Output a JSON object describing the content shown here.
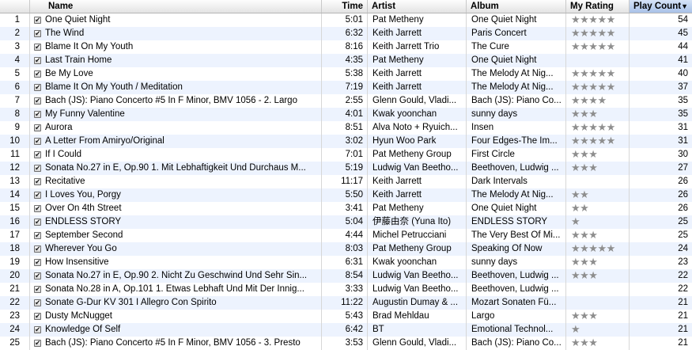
{
  "columns": {
    "name": "Name",
    "time": "Time",
    "artist": "Artist",
    "album": "Album",
    "rating": "My Rating",
    "plays": "Play Count",
    "sort_indicator": "▼"
  },
  "tracks": [
    {
      "num": "1",
      "name": "One Quiet Night",
      "time": "5:01",
      "artist": "Pat Metheny",
      "album": "One Quiet Night",
      "rating": "★★★★★",
      "plays": "54"
    },
    {
      "num": "2",
      "name": "The Wind",
      "time": "6:32",
      "artist": "Keith Jarrett",
      "album": "Paris Concert",
      "rating": "★★★★★",
      "plays": "45"
    },
    {
      "num": "3",
      "name": "Blame It On My Youth",
      "time": "8:16",
      "artist": "Keith Jarrett Trio",
      "album": "The Cure",
      "rating": "★★★★★",
      "plays": "44"
    },
    {
      "num": "4",
      "name": "Last Train Home",
      "time": "4:35",
      "artist": "Pat Metheny",
      "album": "One Quiet Night",
      "rating": "",
      "plays": "41"
    },
    {
      "num": "5",
      "name": "Be My Love",
      "time": "5:38",
      "artist": "Keith Jarrett",
      "album": "The Melody At Nig...",
      "rating": "★★★★★",
      "plays": "40"
    },
    {
      "num": "6",
      "name": "Blame It On My Youth / Meditation",
      "time": "7:19",
      "artist": "Keith Jarrett",
      "album": "The Melody At Nig...",
      "rating": "★★★★★",
      "plays": "37"
    },
    {
      "num": "7",
      "name": "Bach (JS): Piano Concerto #5 In F Minor, BMV 1056 - 2. Largo",
      "time": "2:55",
      "artist": "Glenn Gould, Vladi...",
      "album": "Bach (JS): Piano Co...",
      "rating": "★★★★",
      "plays": "35"
    },
    {
      "num": "8",
      "name": "My Funny Valentine",
      "time": "4:01",
      "artist": "Kwak yoonchan",
      "album": "sunny days",
      "rating": "★★★",
      "plays": "35"
    },
    {
      "num": "9",
      "name": "Aurora",
      "time": "8:51",
      "artist": "Alva Noto + Ryuich...",
      "album": "Insen",
      "rating": "★★★★★",
      "plays": "31"
    },
    {
      "num": "10",
      "name": "A Letter From Amiryo/Original",
      "time": "3:02",
      "artist": "Hyun Woo Park",
      "album": "Four Edges-The Im...",
      "rating": "★★★★★",
      "plays": "31"
    },
    {
      "num": "11",
      "name": "If I Could",
      "time": "7:01",
      "artist": "Pat Metheny Group",
      "album": "First Circle",
      "rating": "★★★",
      "plays": "30"
    },
    {
      "num": "12",
      "name": "Sonata No.27 in E, Op.90 1. Mit Lebhaftigkeit Und Durchaus M...",
      "time": "5:19",
      "artist": "Ludwig Van Beetho...",
      "album": "Beethoven, Ludwig ...",
      "rating": "★★★",
      "plays": "27"
    },
    {
      "num": "13",
      "name": "Recitative",
      "time": "11:17",
      "artist": "Keith Jarrett",
      "album": "Dark Intervals",
      "rating": "",
      "plays": "26"
    },
    {
      "num": "14",
      "name": "I Loves You, Porgy",
      "time": "5:50",
      "artist": "Keith Jarrett",
      "album": "The Melody At Nig...",
      "rating": "★★",
      "plays": "26"
    },
    {
      "num": "15",
      "name": "Over On 4th Street",
      "time": "3:41",
      "artist": "Pat Metheny",
      "album": "One Quiet Night",
      "rating": "★★",
      "plays": "26"
    },
    {
      "num": "16",
      "name": "ENDLESS STORY",
      "time": "5:04",
      "artist": "伊藤由奈 (Yuna Ito)",
      "album": "ENDLESS STORY",
      "rating": "★",
      "plays": "25"
    },
    {
      "num": "17",
      "name": "September Second",
      "time": "4:44",
      "artist": "Michel Petrucciani",
      "album": "The Very Best Of Mi...",
      "rating": "★★★",
      "plays": "25"
    },
    {
      "num": "18",
      "name": "Wherever You Go",
      "time": "8:03",
      "artist": "Pat Metheny Group",
      "album": "Speaking Of Now",
      "rating": "★★★★★",
      "plays": "24"
    },
    {
      "num": "19",
      "name": "How Insensitive",
      "time": "6:31",
      "artist": "Kwak yoonchan",
      "album": "sunny days",
      "rating": "★★★",
      "plays": "23"
    },
    {
      "num": "20",
      "name": "Sonata No.27 in E, Op.90 2. Nicht Zu Geschwind Und Sehr Sin...",
      "time": "8:54",
      "artist": "Ludwig Van Beetho...",
      "album": "Beethoven, Ludwig ...",
      "rating": "★★★",
      "plays": "22"
    },
    {
      "num": "21",
      "name": "Sonata No.28 in A, Op.101 1. Etwas Lebhaft Und Mit Der Innig...",
      "time": "3:33",
      "artist": "Ludwig Van Beetho...",
      "album": "Beethoven, Ludwig ...",
      "rating": "",
      "plays": "22"
    },
    {
      "num": "22",
      "name": "Sonate G-Dur KV 301 I Allegro Con Spirito",
      "time": "11:22",
      "artist": "Augustin Dumay & ...",
      "album": "Mozart Sonaten Fü...",
      "rating": "",
      "plays": "21"
    },
    {
      "num": "23",
      "name": "Dusty McNugget",
      "time": "5:43",
      "artist": "Brad Mehldau",
      "album": "Largo",
      "rating": "★★★",
      "plays": "21"
    },
    {
      "num": "24",
      "name": "Knowledge Of Self",
      "time": "6:42",
      "artist": "BT",
      "album": "Emotional Technol...",
      "rating": "★",
      "plays": "21"
    },
    {
      "num": "25",
      "name": "Bach (JS): Piano Concerto #5 In F Minor, BMV 1056 - 3. Presto",
      "time": "3:53",
      "artist": "Glenn Gould, Vladi...",
      "album": "Bach (JS): Piano Co...",
      "rating": "★★★",
      "plays": "21"
    }
  ]
}
